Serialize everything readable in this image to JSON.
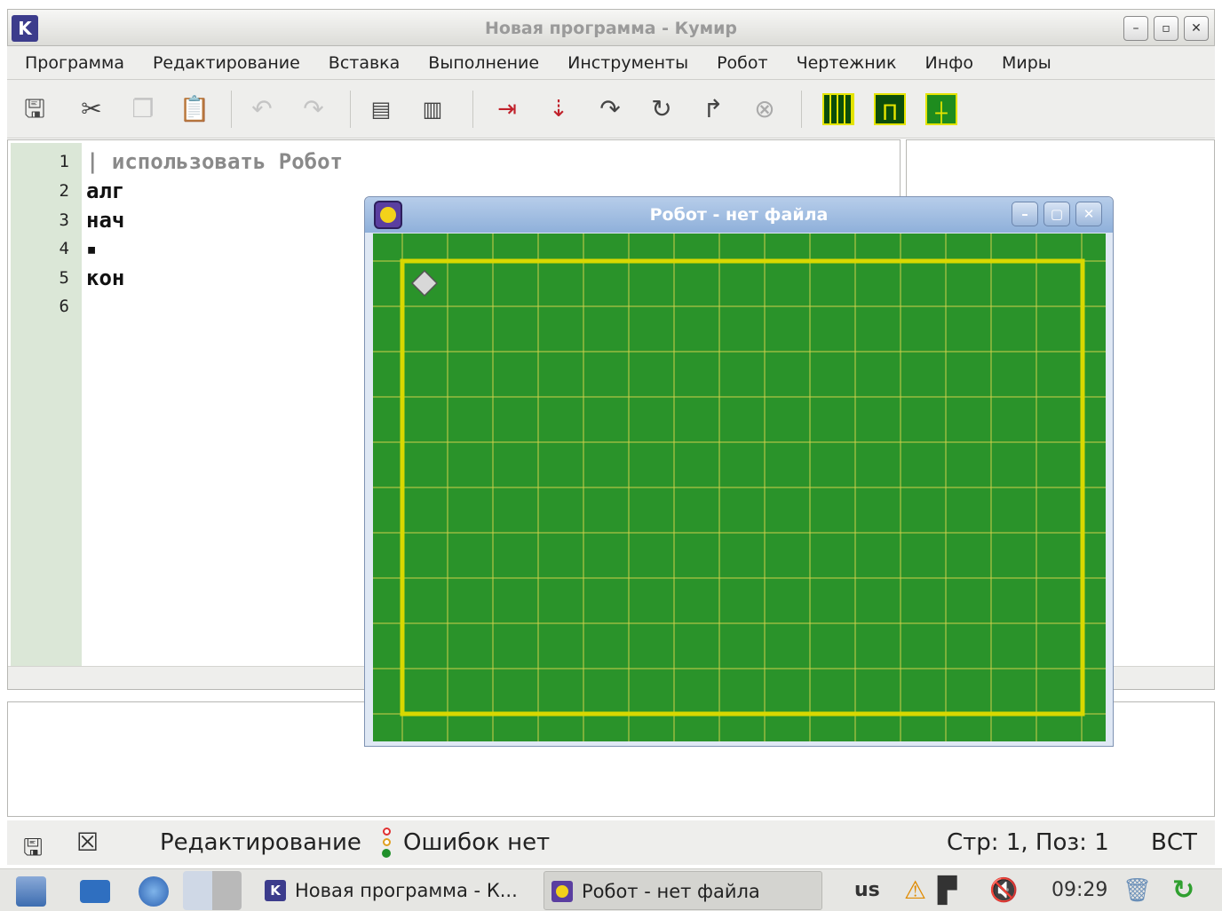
{
  "window": {
    "title": "Новая программа - Кумир",
    "app_icon_letter": "K",
    "minimize": "–",
    "maximize": "▫",
    "close": "✕"
  },
  "menu": [
    "Программа",
    "Редактирование",
    "Вставка",
    "Выполнение",
    "Инструменты",
    "Робот",
    "Чертежник",
    "Инфо",
    "Миры"
  ],
  "toolbar": {
    "icons": [
      "save-icon",
      "cut-icon",
      "copy-icon",
      "paste-icon",
      "undo-icon",
      "redo-icon",
      "comment-icon",
      "uncomment-icon",
      "run-icon",
      "step-icon",
      "step-into-icon",
      "step-over-icon",
      "step-out-icon",
      "stop-icon",
      "robot-field-icon",
      "robot-control-icon",
      "draw-field-icon"
    ]
  },
  "editor": {
    "line_numbers": [
      "1",
      "2",
      "3",
      "4",
      "5",
      "6"
    ],
    "lines": [
      "| использовать Робот",
      "алг",
      "нач",
      "▪",
      "кон",
      ""
    ]
  },
  "robot_window": {
    "title": "Робот - нет файла",
    "minimize": "–",
    "maximize": "▢",
    "close": "✕",
    "field": {
      "background": "#2a932a",
      "grid_color": "#d2d24a",
      "wall_color": "#d8d800",
      "robot_color": "#d8d8d8"
    }
  },
  "status": {
    "mode": "Редактирование",
    "errors": "Ошибок нет",
    "position": "Стр: 1, Поз: 1",
    "insert_mode": "ВСТ"
  },
  "taskbar": {
    "tasks": [
      "Новая программа - К...",
      "Робот - нет файла"
    ],
    "keyboard": "us",
    "clock": "09:29"
  }
}
